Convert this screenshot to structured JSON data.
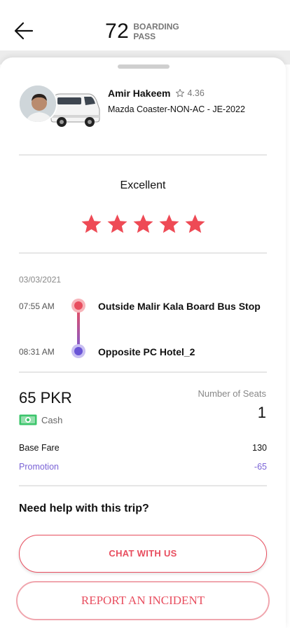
{
  "header": {
    "number": "72",
    "subtitle_line1": "BOARDING",
    "subtitle_line2": "PASS"
  },
  "driver": {
    "name": "Amir Hakeem",
    "rating": "4.36",
    "vehicle": "Mazda Coaster-NON-AC - JE-2022"
  },
  "feedback": {
    "label": "Excellent",
    "stars": 5,
    "max_stars": 5
  },
  "trip": {
    "date": "03/03/2021",
    "stops": [
      {
        "time": "07:55 AM",
        "name": "Outside Malir Kala Board Bus Stop"
      },
      {
        "time": "08:31 AM",
        "name": "Opposite PC Hotel_2"
      }
    ]
  },
  "fare": {
    "amount": "65 PKR",
    "payment_method": "Cash",
    "seats_label": "Number of Seats",
    "seats_value": "1",
    "lines": [
      {
        "label": "Base Fare",
        "value": "130"
      },
      {
        "label": "Promotion",
        "value": "-65"
      }
    ]
  },
  "help": {
    "title": "Need help with this trip?",
    "chat_label": "CHAT WITH US",
    "report_label": "REPORT AN INCIDENT"
  },
  "colors": {
    "accent": "#e84e5f",
    "promo": "#7a63d6",
    "cash": "#3cc56b"
  }
}
